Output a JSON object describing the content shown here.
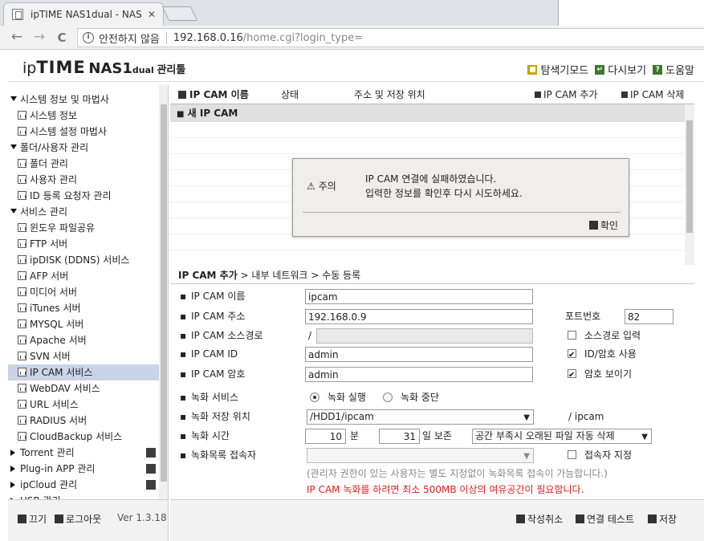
{
  "browser": {
    "tab_title": "ipTIME NAS1dual - NAS",
    "tab_close": "✕",
    "back": "←",
    "forward": "→",
    "reload": "C",
    "security_text": "안전하지 않음",
    "url_host": "192.168.0.16",
    "url_path": "/home.cgi?login_type="
  },
  "header": {
    "logo_ip": "ip",
    "logo_time": "TIME",
    "logo_model": "NAS1",
    "logo_dual": "dual",
    "logo_mgr": "관리툴",
    "explorer_mode": "탐색기모드",
    "refresh": "다시보기",
    "help": "도움말"
  },
  "sidebar": {
    "items": [
      {
        "label": "시스템 정보 및 마법사",
        "type": "group",
        "expanded": true
      },
      {
        "label": "시스템 정보",
        "type": "sub"
      },
      {
        "label": "시스템 설정 마법사",
        "type": "sub"
      },
      {
        "label": "폴더/사용자 관리",
        "type": "group",
        "expanded": true
      },
      {
        "label": "폴더 관리",
        "type": "sub"
      },
      {
        "label": "사용자 관리",
        "type": "sub"
      },
      {
        "label": "ID 등록 요청자 관리",
        "type": "sub"
      },
      {
        "label": "서비스 관리",
        "type": "group",
        "expanded": true
      },
      {
        "label": "윈도우 파일공유",
        "type": "sub"
      },
      {
        "label": "FTP 서버",
        "type": "sub"
      },
      {
        "label": "ipDISK (DDNS) 서비스",
        "type": "sub"
      },
      {
        "label": "AFP 서버",
        "type": "sub"
      },
      {
        "label": "미디어 서버",
        "type": "sub"
      },
      {
        "label": "iTunes 서버",
        "type": "sub"
      },
      {
        "label": "MYSQL 서버",
        "type": "sub"
      },
      {
        "label": "Apache 서버",
        "type": "sub"
      },
      {
        "label": "SVN 서버",
        "type": "sub"
      },
      {
        "label": "IP CAM 서비스",
        "type": "sub",
        "selected": true
      },
      {
        "label": "WebDAV 서비스",
        "type": "sub"
      },
      {
        "label": "URL 서비스",
        "type": "sub"
      },
      {
        "label": "RADIUS 서버",
        "type": "sub"
      },
      {
        "label": "CloudBackup 서비스",
        "type": "sub"
      },
      {
        "label": "Torrent 관리",
        "type": "group",
        "expanded": false
      },
      {
        "label": "Plug-in APP 관리",
        "type": "group",
        "expanded": false
      },
      {
        "label": "ipCloud 관리",
        "type": "group",
        "expanded": false
      },
      {
        "label": "USB 관리",
        "type": "group",
        "expanded": false
      }
    ],
    "power_off": "끄기",
    "logout": "로그아웃",
    "version": "Ver 1.3.18"
  },
  "list": {
    "col_name": "IP CAM 이름",
    "col_status": "상태",
    "col_address": "주소 및 저장 위치",
    "add": "IP CAM 추가",
    "delete": "IP CAM 삭제",
    "row0": "새 IP CAM"
  },
  "form": {
    "title": "IP CAM 추가",
    "breadcrumb": " > 내부 네트워크 > 수동 등록",
    "name_label": "IP CAM 이름",
    "name_value": "ipcam",
    "addr_label": "IP CAM 주소",
    "addr_value": "192.168.0.9",
    "port_label": "포트번호",
    "port_value": "82",
    "srcpath_label": "IP CAM 소스경로",
    "srcpath_prefix": "/",
    "srcpath_value": "",
    "srcpath_input": "소스경로 입력",
    "id_label": "IP CAM ID",
    "id_value": "admin",
    "id_use": "ID/암호 사용",
    "pw_label": "IP CAM 암호",
    "pw_value": "admin",
    "pw_show": "암호 보이기",
    "rec_label": "녹화 서비스",
    "rec_run": "녹화 실행",
    "rec_stop": "녹화 중단",
    "loc_label": "녹화 저장 위치",
    "loc_value": "/HDD1/ipcam",
    "loc_suffix": "/ ipcam",
    "time_label": "녹화 시간",
    "minutes_value": "10",
    "minutes_unit": "분",
    "days_value": "31",
    "days_unit": "일 보존",
    "retention_option": "공간 부족시 오래된 파일 자동 삭제",
    "viewer_label": "녹화목록 접속자",
    "viewer_value": "",
    "viewer_specify": "접속자 지정",
    "note_gray": "(관리자 권한이 있는 사용자는 별도 지정없이 녹화목록 접속이 가능합니다.)",
    "note_red": "IP CAM 녹화를 하려면 최소 500MB 이상의 여유공간이 필요합니다."
  },
  "actions": {
    "cancel": "작성취소",
    "test": "연결 테스트",
    "save": "저장"
  },
  "dialog": {
    "title": "주의",
    "line1": "IP CAM 연결에 실패하였습니다.",
    "line2": "입력한 정보를 확인후 다시 시도하세요.",
    "ok": "확인"
  },
  "colors": {
    "selected_row": "#c9d4e8",
    "warning_red": "#e02020",
    "dialog_bg": "#f0eeea"
  }
}
